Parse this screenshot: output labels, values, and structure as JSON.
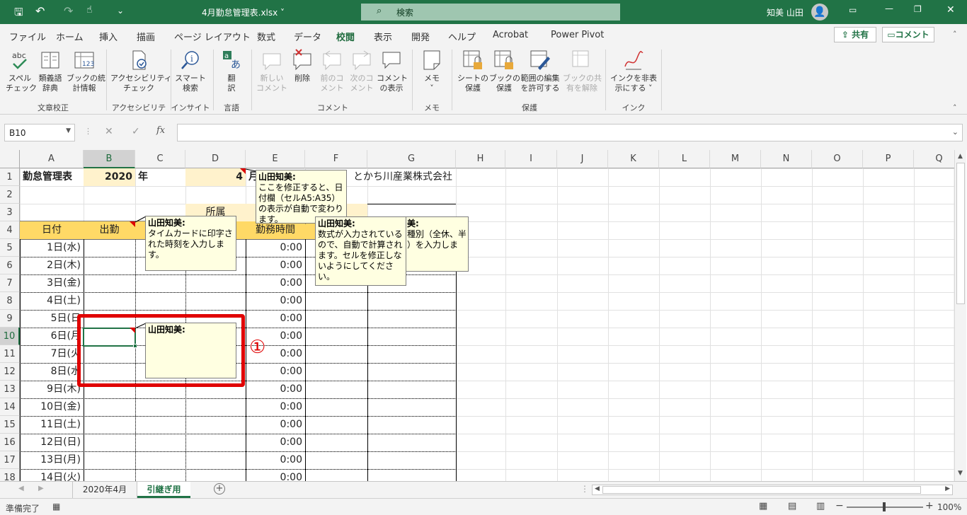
{
  "window": {
    "file_title": "4月勤怠管理表.xlsx ˅",
    "search_placeholder": "検索",
    "user_name": "知美 山田"
  },
  "ribbon_tabs": [
    "ファイル",
    "ホーム",
    "挿入",
    "描画",
    "ページ レイアウト",
    "数式",
    "データ",
    "校閲",
    "表示",
    "開発",
    "ヘルプ",
    "Acrobat",
    "Power Pivot"
  ],
  "active_tab": "校閲",
  "share": {
    "share_label": "共有",
    "comment_label": "コメント"
  },
  "ribbon": {
    "spell": "スペル\nチェック",
    "thesaurus": "類義語\n辞典",
    "stats": "ブックの統\n計情報",
    "group_proofing": "文章校正",
    "access": "アクセシビリティ\nチェック",
    "group_access": "アクセシビリティ",
    "smart": "スマート\n検索",
    "group_insight": "インサイト",
    "translate": "翻\n訳",
    "group_lang": "言語",
    "new_comment": "新しい\nコメント",
    "delete": "削除",
    "prev": "前のコ\nメント",
    "next": "次のコ\nメント",
    "show": "コメント\nの表示",
    "group_comment": "コメント",
    "memo": "メモ\n˅",
    "group_memo": "メモ",
    "protect_sheet": "シートの\n保護",
    "protect_book": "ブックの\n保護",
    "allow_edit": "範囲の編集\nを許可する",
    "unshare": "ブックの共\n有を解除",
    "group_protect": "保護",
    "hide_ink": "インクを非表\n示にする ˅",
    "group_ink": "インク"
  },
  "namebox": "B10",
  "columns": [
    "A",
    "B",
    "C",
    "D",
    "E",
    "F",
    "G",
    "H",
    "I",
    "J",
    "K",
    "L",
    "M",
    "N",
    "O",
    "P",
    "Q"
  ],
  "rows": [
    "1",
    "2",
    "3",
    "4",
    "5",
    "6",
    "7",
    "8",
    "9",
    "10",
    "11",
    "12",
    "13",
    "14",
    "15",
    "16",
    "17",
    "18"
  ],
  "cells": {
    "A1": "勤怠管理表",
    "B1": "2020",
    "C1": "年",
    "D1": "4",
    "E1": "月",
    "G1": "とかち川産業株式会社",
    "D3": "所属",
    "A4": "日付",
    "B4": "出勤",
    "E4": "勤務時間",
    "dates": [
      "1日(水)",
      "2日(木)",
      "3日(金)",
      "4日(土)",
      "5日(日",
      "6日(月",
      "7日(火",
      "8日(水",
      "9日(木)",
      "10日(金)",
      "11日(土)",
      "12日(日)",
      "13日(月)",
      "14日(火)"
    ],
    "hours": [
      "0:00",
      "0:00",
      "0:00",
      "0:00",
      "0:00",
      "0:00",
      "0:00",
      "0:00",
      "0:00",
      "0:00",
      "0:00",
      "0:00",
      "0:00",
      "0:00"
    ]
  },
  "comments": {
    "c1_author": "山田知美:",
    "c1_text": "タイムカードに印字された時刻を入力します。",
    "c2_author": "山田知美:",
    "c2_text": "ここを修正すると、日付欄（セルA5:A35）の表示が自動で変わります。",
    "c3_author": "山田知美:",
    "c3_text": "数式が入力されているので、自動で計算されます。セルを修正しないようにしてください。",
    "c4_author": "美:",
    "c4_text": "種別（全休、半\n）を入力しま",
    "c5_author": "山田知美:"
  },
  "step_marker": "①",
  "sheet_tabs": [
    "2020年4月",
    "引継ぎ用"
  ],
  "active_sheet": "引継ぎ用",
  "status": {
    "ready": "準備完了",
    "zoom": "100%"
  }
}
